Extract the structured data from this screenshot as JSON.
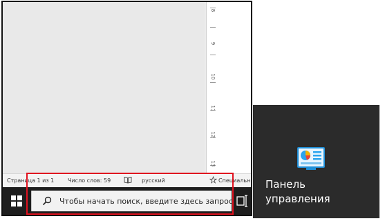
{
  "status_bar": {
    "page": "Страница 1 из 1",
    "words": "Число слов: 59",
    "language": "русский",
    "special": "Специальн"
  },
  "taskbar": {
    "search_placeholder": "Чтобы начать поиск, введите здесь запрос"
  },
  "ruler": {
    "numbers": [
      "8",
      "9",
      "10",
      "11",
      "12",
      "13"
    ]
  },
  "control_panel": {
    "label_line1": "Панель",
    "label_line2": "управления"
  },
  "colors": {
    "highlight": "#e0121f",
    "taskbar": "#1e1e1e",
    "tile_bg": "#2b2b2b"
  }
}
